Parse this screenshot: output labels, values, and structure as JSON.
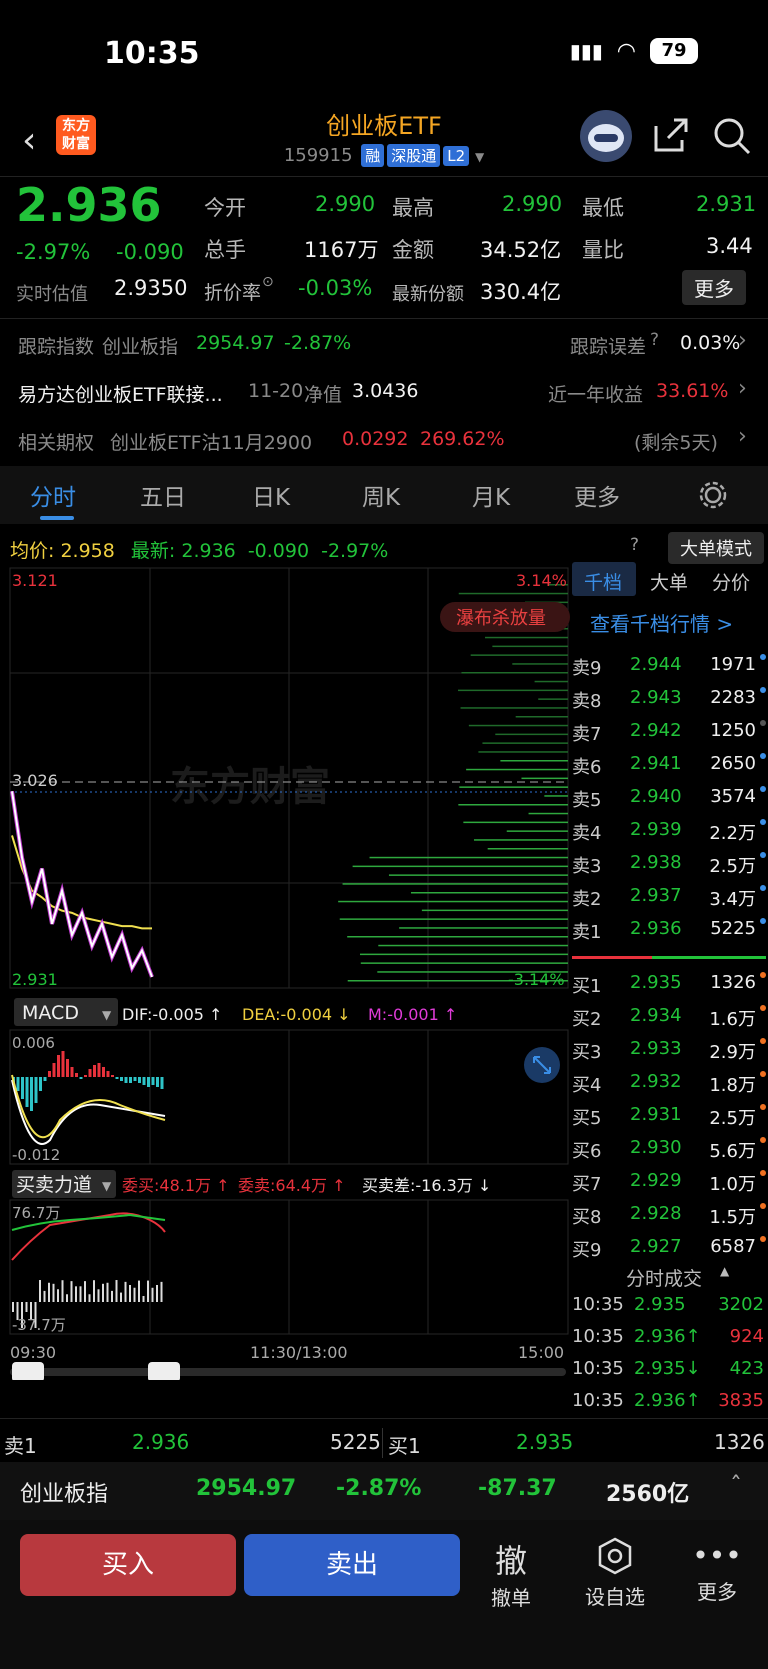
{
  "status": {
    "time": "10:35",
    "battery": "79"
  },
  "header": {
    "title": "创业板ETF",
    "code": "159915",
    "tags": [
      "融",
      "深股通",
      "L2"
    ],
    "logo_text": "东方财富"
  },
  "quote": {
    "price": "2.936",
    "change_pct": "-2.97%",
    "change": "-0.090",
    "iopv_label": "实时估值",
    "iopv": "2.9350",
    "open_label": "今开",
    "open": "2.990",
    "high_label": "最高",
    "high": "2.990",
    "low_label": "最低",
    "low": "2.931",
    "volume_label": "总手",
    "volume": "1167万",
    "amount_label": "金额",
    "amount": "34.52亿",
    "ratio_label": "量比",
    "ratio": "3.44",
    "discount_label": "折价率",
    "discount": "-0.03%",
    "shares_label": "最新份额",
    "shares": "330.4亿",
    "more": "更多"
  },
  "tracking": {
    "label": "跟踪指数",
    "index_name": "创业板指",
    "index_value": "2954.97",
    "index_pct": "-2.87%",
    "error_label": "跟踪误差",
    "error_value": "0.03%"
  },
  "fund": {
    "name": "易方达创业板ETF联接...",
    "date": "11-20",
    "nav_label": "净值",
    "nav": "3.0436",
    "return_label": "近一年收益",
    "return_value": "33.61%"
  },
  "option": {
    "label": "相关期权",
    "name": "创业板ETF沽11月2900",
    "price": "0.0292",
    "pct": "269.62%",
    "remain": "(剩余5天)"
  },
  "tabs": [
    "分时",
    "五日",
    "日K",
    "周K",
    "月K",
    "更多"
  ],
  "chart_header": {
    "avg_label": "均价:",
    "avg": "2.958",
    "last_label": "最新:",
    "last": "2.936",
    "chg": "-0.090",
    "pct": "-2.97%",
    "mode_btn": "大单模式"
  },
  "chart_data": {
    "type": "line",
    "y_top": "3.121",
    "y_mid": "3.026",
    "y_bot": "2.931",
    "pct_top": "3.14%",
    "pct_bot": "-3.14%",
    "x_labels": [
      "09:30",
      "11:30/13:00",
      "15:00"
    ],
    "watermark": "东方财富",
    "badge": "瀑布杀放量",
    "series": [
      {
        "name": "price",
        "color": "#ffffff",
        "values": [
          3.02,
          2.99,
          2.97,
          2.985,
          2.96,
          2.975,
          2.955,
          2.965,
          2.95,
          2.96,
          2.945,
          2.955,
          2.94,
          2.948,
          2.936
        ]
      },
      {
        "name": "avg",
        "color": "#f0e050",
        "values": [
          3.0,
          2.985,
          2.975,
          2.972,
          2.968,
          2.966,
          2.965,
          2.963,
          2.962,
          2.961,
          2.96,
          2.959,
          2.959,
          2.958,
          2.958
        ]
      }
    ]
  },
  "macd": {
    "label": "MACD",
    "dif": "DIF:-0.005 ↑",
    "dea": "DEA:-0.004 ↓",
    "m": "M:-0.001 ↑",
    "top": "0.006",
    "bot": "-0.012"
  },
  "force": {
    "label": "买卖力道",
    "buy": "委买:48.1万 ↑",
    "sell": "委卖:64.4万 ↑",
    "diff": "买卖差:-16.3万 ↓",
    "top": "76.7万",
    "bot": "-37.7万"
  },
  "orderbook": {
    "tabs": [
      "千档",
      "大单",
      "分价"
    ],
    "link": "查看千档行情 >",
    "asks": [
      {
        "label": "卖9",
        "price": "2.944",
        "vol": "1971"
      },
      {
        "label": "卖8",
        "price": "2.943",
        "vol": "2283"
      },
      {
        "label": "卖7",
        "price": "2.942",
        "vol": "1250"
      },
      {
        "label": "卖6",
        "price": "2.941",
        "vol": "2650"
      },
      {
        "label": "卖5",
        "price": "2.940",
        "vol": "3574"
      },
      {
        "label": "卖4",
        "price": "2.939",
        "vol": "2.2万"
      },
      {
        "label": "卖3",
        "price": "2.938",
        "vol": "2.5万"
      },
      {
        "label": "卖2",
        "price": "2.937",
        "vol": "3.4万"
      },
      {
        "label": "卖1",
        "price": "2.936",
        "vol": "5225"
      }
    ],
    "bids": [
      {
        "label": "买1",
        "price": "2.935",
        "vol": "1326"
      },
      {
        "label": "买2",
        "price": "2.934",
        "vol": "1.6万"
      },
      {
        "label": "买3",
        "price": "2.933",
        "vol": "2.9万"
      },
      {
        "label": "买4",
        "price": "2.932",
        "vol": "1.8万"
      },
      {
        "label": "买5",
        "price": "2.931",
        "vol": "2.5万"
      },
      {
        "label": "买6",
        "price": "2.930",
        "vol": "5.6万"
      },
      {
        "label": "买7",
        "price": "2.929",
        "vol": "1.0万"
      },
      {
        "label": "买8",
        "price": "2.928",
        "vol": "1.5万"
      },
      {
        "label": "买9",
        "price": "2.927",
        "vol": "6587"
      }
    ],
    "ticks_label": "分时成交",
    "ticks": [
      {
        "time": "10:35",
        "price": "2.935",
        "vol": "3202"
      },
      {
        "time": "10:35",
        "price": "2.936↑",
        "vol": "924"
      },
      {
        "time": "10:35",
        "price": "2.935↓",
        "vol": "423"
      },
      {
        "time": "10:35",
        "price": "2.936↑",
        "vol": "3835"
      }
    ]
  },
  "level1": {
    "ask_label": "卖1",
    "ask_price": "2.936",
    "ask_vol": "5225",
    "bid_label": "买1",
    "bid_price": "2.935",
    "bid_vol": "1326"
  },
  "index_bar": {
    "name": "创业板指",
    "value": "2954.97",
    "pct": "-2.87%",
    "chg": "-87.37",
    "amount": "2560亿"
  },
  "actions": {
    "buy": "买入",
    "sell": "卖出",
    "cancel_icon": "撤",
    "cancel": "撤单",
    "favorite": "设自选",
    "more": "更多"
  }
}
